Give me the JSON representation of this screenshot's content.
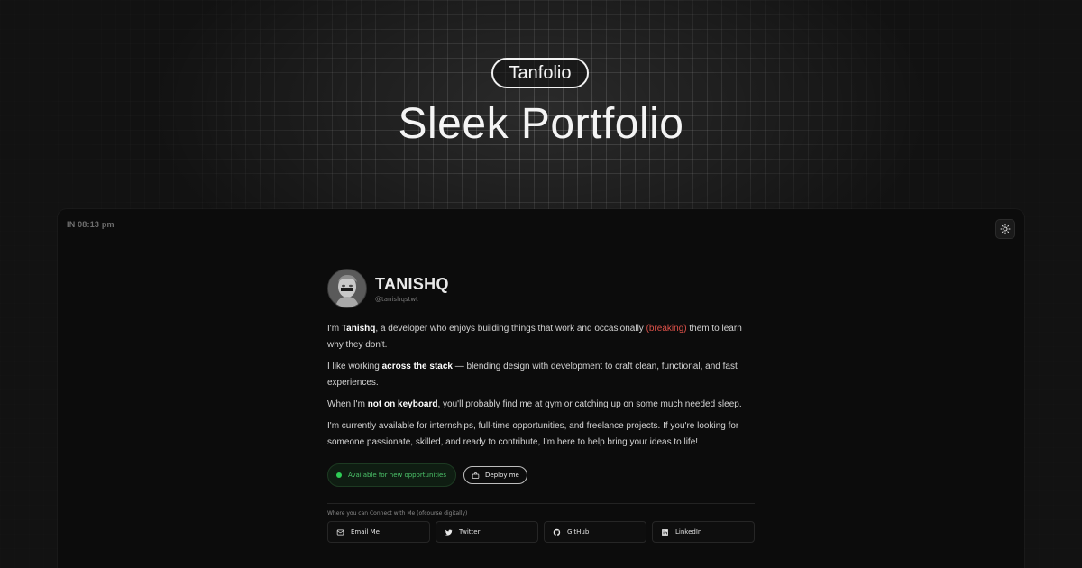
{
  "header": {
    "brand": "Tanfolio",
    "title": "Sleek Portfolio"
  },
  "window": {
    "clock": "IN 08:13 pm",
    "theme_toggle_icon": "sun-icon"
  },
  "profile": {
    "name": "TANISHQ",
    "handle": "@tanishqstwt",
    "avatar_icon": "statue-avatar"
  },
  "bio": {
    "p1_pre": "I'm ",
    "p1_name": "Tanishq",
    "p1_mid": ", a developer who enjoys building things that work and occasionally ",
    "p1_breaking": "(breaking)",
    "p1_post": " them to learn why they don't.",
    "p2_pre": "I like working ",
    "p2_bold": "across the stack",
    "p2_post": " — blending design with development to craft clean, functional, and fast experiences.",
    "p3_pre": "When I'm ",
    "p3_bold": "not on keyboard",
    "p3_post": ", you'll probably find me at gym or catching up on some much needed sleep.",
    "p4": "I'm currently available for internships, full-time opportunities, and freelance projects. If you're looking for someone passionate, skilled, and ready to contribute, I'm here to help bring your ideas to life!"
  },
  "actions": {
    "status": "Available for new opportunities",
    "deploy": "Deploy me"
  },
  "connect": {
    "label": "Where you can Connect with Me (ofcourse digitally)",
    "links": [
      {
        "label": "Email Me",
        "icon": "mail-icon"
      },
      {
        "label": "Twitter",
        "icon": "twitter-icon"
      },
      {
        "label": "GitHub",
        "icon": "github-icon"
      },
      {
        "label": "LinkedIn",
        "icon": "linkedin-icon"
      }
    ]
  },
  "colors": {
    "background": "#121212",
    "window": "#0c0c0c",
    "accent_red": "#e0524a",
    "status_green": "#2ecc55"
  }
}
